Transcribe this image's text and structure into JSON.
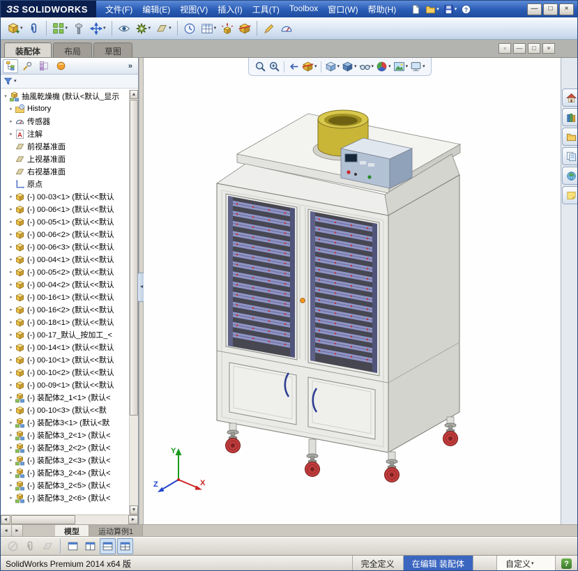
{
  "window": {
    "logo_mark": "ЗS",
    "logo_text": "SOLIDWORKS",
    "controls": [
      {
        "name": "minimize-window",
        "glyph": "—"
      },
      {
        "name": "maximize-window",
        "glyph": "□"
      },
      {
        "name": "close-window",
        "glyph": "×"
      }
    ]
  },
  "menubar": {
    "items": [
      {
        "name": "file",
        "label": "文件(F)"
      },
      {
        "name": "edit",
        "label": "编辑(E)"
      },
      {
        "name": "view",
        "label": "视图(V)"
      },
      {
        "name": "insert",
        "label": "插入(I)"
      },
      {
        "name": "tools",
        "label": "工具(T)"
      },
      {
        "name": "toolbox",
        "label": "Toolbox"
      },
      {
        "name": "window",
        "label": "窗口(W)"
      },
      {
        "name": "help",
        "label": "帮助(H)"
      }
    ]
  },
  "quick_access": [
    {
      "name": "new-document",
      "glyph": "page"
    },
    {
      "name": "open-document",
      "glyph": "folderY",
      "dd": true
    },
    {
      "name": "save-document",
      "glyph": "disk",
      "dd": true
    },
    {
      "name": "help",
      "glyph": "helpQ"
    }
  ],
  "assembly_toolbar": [
    {
      "name": "insert-component",
      "glyph": "cubeplus",
      "dd": true
    },
    {
      "name": "mate",
      "glyph": "clip"
    },
    {
      "sep": true
    },
    {
      "name": "linear-component-pattern",
      "glyph": "grid",
      "dd": true
    },
    {
      "name": "smart-fasteners",
      "glyph": "bolt"
    },
    {
      "name": "move-component",
      "glyph": "movearrows",
      "dd": true
    },
    {
      "sep": true
    },
    {
      "name": "show-hidden-components",
      "glyph": "eye"
    },
    {
      "name": "assembly-features",
      "glyph": "gear",
      "dd": true
    },
    {
      "name": "reference-geometry",
      "glyph": "planeicon",
      "dd": true
    },
    {
      "sep": true
    },
    {
      "name": "new-motion-study",
      "glyph": "clock"
    },
    {
      "name": "bill-of-materials",
      "glyph": "tableIcon",
      "dd": true
    },
    {
      "name": "exploded-view",
      "glyph": "explode"
    },
    {
      "name": "interference-detection",
      "glyph": "cutcube"
    },
    {
      "sep": true
    },
    {
      "name": "instant3d",
      "glyph": "pencil"
    },
    {
      "name": "large-assembly-mode",
      "glyph": "gauge"
    }
  ],
  "commandmanager": {
    "tabs": [
      {
        "name": "assembly",
        "label": "装配体"
      },
      {
        "name": "layout",
        "label": "布局"
      },
      {
        "name": "sketch",
        "label": "草图"
      }
    ],
    "active": 0,
    "controls": [
      {
        "name": "pin-commandmanager",
        "glyph": "▫"
      },
      {
        "name": "minimize-document",
        "glyph": "—"
      },
      {
        "name": "restore-document",
        "glyph": "□"
      },
      {
        "name": "close-document",
        "glyph": "×"
      }
    ]
  },
  "feature_panel": {
    "tabs": [
      {
        "name": "featuremanager-design-tree",
        "glyph": "treeicon",
        "active": true
      },
      {
        "name": "propertymanager",
        "glyph": "wrenchGear"
      },
      {
        "name": "configurationmanager",
        "glyph": "configIcon"
      },
      {
        "name": "displaymanager",
        "glyph": "displayIcon"
      }
    ],
    "overflow": "»",
    "filter_arrow": "▾"
  },
  "tree": {
    "items": [
      {
        "type": "assembly",
        "label": "抽風乾燥機 (默认<默认_显示",
        "root": true,
        "exp": "▾"
      },
      {
        "type": "history",
        "label": "History",
        "exp": "▸"
      },
      {
        "type": "sensors",
        "label": "传感器",
        "exp": "▸"
      },
      {
        "type": "annotations",
        "label": "注解",
        "exp": "▸"
      },
      {
        "type": "plane",
        "label": "前视基准面",
        "exp": ""
      },
      {
        "type": "plane",
        "label": "上视基准面",
        "exp": ""
      },
      {
        "type": "plane",
        "label": "右视基准面",
        "exp": ""
      },
      {
        "type": "origin",
        "label": "原点",
        "exp": ""
      },
      {
        "type": "part",
        "label": "(-) 00-03<1> (默认<<默认",
        "exp": "▸"
      },
      {
        "type": "part",
        "label": "(-) 00-06<1> (默认<<默认",
        "exp": "▸"
      },
      {
        "type": "part",
        "label": "(-) 00-05<1> (默认<<默认",
        "exp": "▸"
      },
      {
        "type": "part",
        "label": "(-) 00-06<2> (默认<<默认",
        "exp": "▸"
      },
      {
        "type": "part",
        "label": "(-) 00-06<3> (默认<<默认",
        "exp": "▸"
      },
      {
        "type": "part",
        "label": "(-) 00-04<1> (默认<<默认",
        "exp": "▸"
      },
      {
        "type": "part",
        "label": "(-) 00-05<2> (默认<<默认",
        "exp": "▸"
      },
      {
        "type": "part",
        "label": "(-) 00-04<2> (默认<<默认",
        "exp": "▸"
      },
      {
        "type": "part",
        "label": "(-) 00-16<1> (默认<<默认",
        "exp": "▸"
      },
      {
        "type": "part",
        "label": "(-) 00-16<2> (默认<<默认",
        "exp": "▸"
      },
      {
        "type": "part",
        "label": "(-) 00-18<1> (默认<<默认",
        "exp": "▸"
      },
      {
        "type": "part",
        "label": "(-) 00-17_默认_按加工_<",
        "exp": "▸"
      },
      {
        "type": "part",
        "label": "(-) 00-14<1> (默认<<默认",
        "exp": "▸"
      },
      {
        "type": "part",
        "label": "(-) 00-10<1> (默认<<默认",
        "exp": "▸"
      },
      {
        "type": "part",
        "label": "(-) 00-10<2> (默认<<默认",
        "exp": "▸"
      },
      {
        "type": "part",
        "label": "(-) 00-09<1> (默认<<默认",
        "exp": "▸"
      },
      {
        "type": "subassembly",
        "label": "(-) 装配体2_1<1> (默认<",
        "exp": "▸"
      },
      {
        "type": "part",
        "label": "(-) 00-10<3> (默认<<默",
        "exp": "▸"
      },
      {
        "type": "subassembly",
        "label": "(-) 装配体3<1> (默认<默",
        "exp": "▸"
      },
      {
        "type": "subassembly",
        "label": "(-) 装配体3_2<1> (默认<",
        "exp": "▸"
      },
      {
        "type": "subassembly",
        "label": "(-) 装配体3_2<2> (默认<",
        "exp": "▸"
      },
      {
        "type": "subassembly",
        "label": "(-) 装配体3_2<3> (默认<",
        "exp": "▸"
      },
      {
        "type": "subassembly",
        "label": "(-) 装配体3_2<4> (默认<",
        "exp": "▸"
      },
      {
        "type": "subassembly",
        "label": "(-) 装配体3_2<5> (默认<",
        "exp": "▸"
      },
      {
        "type": "subassembly",
        "label": "(-) 装配体3_2<6> (默认<",
        "exp": "▸"
      }
    ]
  },
  "headsup": [
    {
      "name": "zoom-to-fit",
      "glyph": "magnifier"
    },
    {
      "name": "zoom-to-area",
      "glyph": "magnifierPlus"
    },
    {
      "sep": true
    },
    {
      "name": "previous-view",
      "glyph": "arrowLeft"
    },
    {
      "name": "section-view",
      "glyph": "cutcube",
      "dd": true
    },
    {
      "sep": true
    },
    {
      "name": "view-orientation",
      "glyph": "vieworient",
      "dd": true
    },
    {
      "name": "display-style",
      "glyph": "shadedcube",
      "dd": true
    },
    {
      "name": "hide-show-items",
      "glyph": "glasses",
      "dd": true
    },
    {
      "name": "edit-appearance",
      "glyph": "ballColor",
      "dd": true
    },
    {
      "name": "apply-scene",
      "glyph": "photo",
      "dd": true
    },
    {
      "name": "view-settings",
      "glyph": "monitor",
      "dd": true
    }
  ],
  "taskpane": [
    {
      "name": "solidworks-resources",
      "glyph": "house"
    },
    {
      "name": "design-library",
      "glyph": "books"
    },
    {
      "name": "file-explorer",
      "glyph": "folderY"
    },
    {
      "name": "view-palette",
      "glyph": "sheets"
    },
    {
      "name": "appearances-scenes",
      "glyph": "globe"
    },
    {
      "name": "custom-properties",
      "glyph": "noteYellow"
    }
  ],
  "motion": {
    "scroll_buttons": [
      {
        "name": "motion-scroll-left",
        "glyph": "◄"
      },
      {
        "name": "motion-scroll-right",
        "glyph": "►"
      }
    ],
    "tabs": [
      {
        "name": "model",
        "label": "模型",
        "active": true
      },
      {
        "name": "motion-study-1",
        "label": "运动算例1",
        "active": false
      }
    ]
  },
  "bottom_toolbar": [
    {
      "name": "selection-filter-off",
      "glyph": "slashcircle",
      "disabled": true
    },
    {
      "name": "filter-edges",
      "glyph": "clip",
      "disabled": true
    },
    {
      "name": "filter-faces",
      "glyph": "planeicon",
      "disabled": true
    },
    {
      "sep": true
    },
    {
      "name": "single-view",
      "glyph": "window1"
    },
    {
      "name": "two-view-horizontal",
      "glyph": "window2"
    },
    {
      "name": "two-view-vertical",
      "glyph": "window3",
      "active": true
    },
    {
      "name": "four-view",
      "glyph": "window4",
      "active": true
    }
  ],
  "statusbar": {
    "left": "SolidWorks Premium 2014 x64 版",
    "cells": [
      {
        "name": "definition-status",
        "label": "完全定义",
        "style": "plain"
      },
      {
        "name": "editing-status",
        "label": "在编辑 装配体",
        "style": "highlight"
      },
      {
        "name": "units-setting",
        "label": "自定义",
        "style": "dropdown"
      },
      {
        "name": "quick-tips",
        "label": "?",
        "style": "help"
      }
    ]
  },
  "triad": {
    "x": "X",
    "y": "Y",
    "z": "Z"
  }
}
